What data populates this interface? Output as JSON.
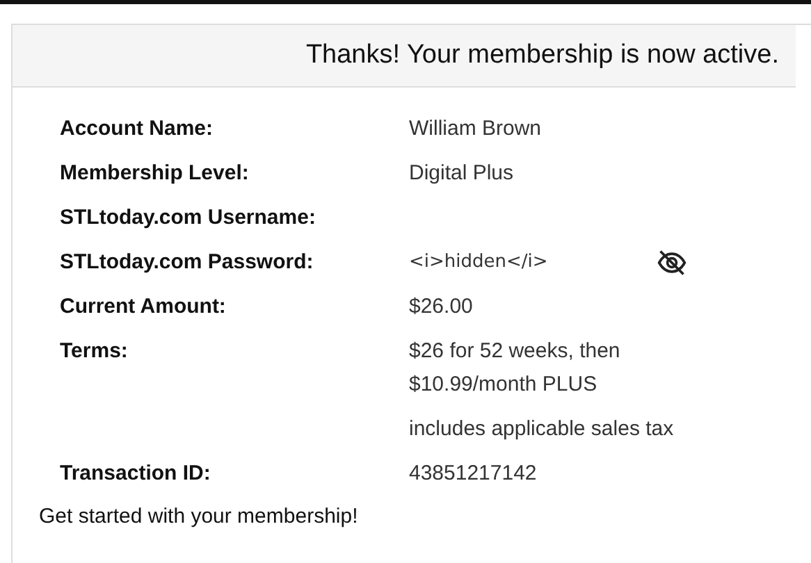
{
  "header": {
    "title": "Thanks! Your membership is now active."
  },
  "details": [
    {
      "label": "Account Name:",
      "value": "William Brown"
    },
    {
      "label": "Membership Level:",
      "value": "Digital Plus"
    },
    {
      "label": "STLtoday.com Username:"
    },
    {
      "label": "STLtoday.com Password:",
      "value": "<i>hidden</i>",
      "kind": "password"
    },
    {
      "label": "Current Amount:",
      "value": "$26.00"
    },
    {
      "label": "Terms:",
      "value": "$26 for 52 weeks, then $10.99/month PLUS",
      "note": "includes applicable sales tax"
    },
    {
      "label": "Transaction ID:",
      "value": "43851217142"
    }
  ],
  "footer": {
    "text": "Get started with your membership!"
  }
}
